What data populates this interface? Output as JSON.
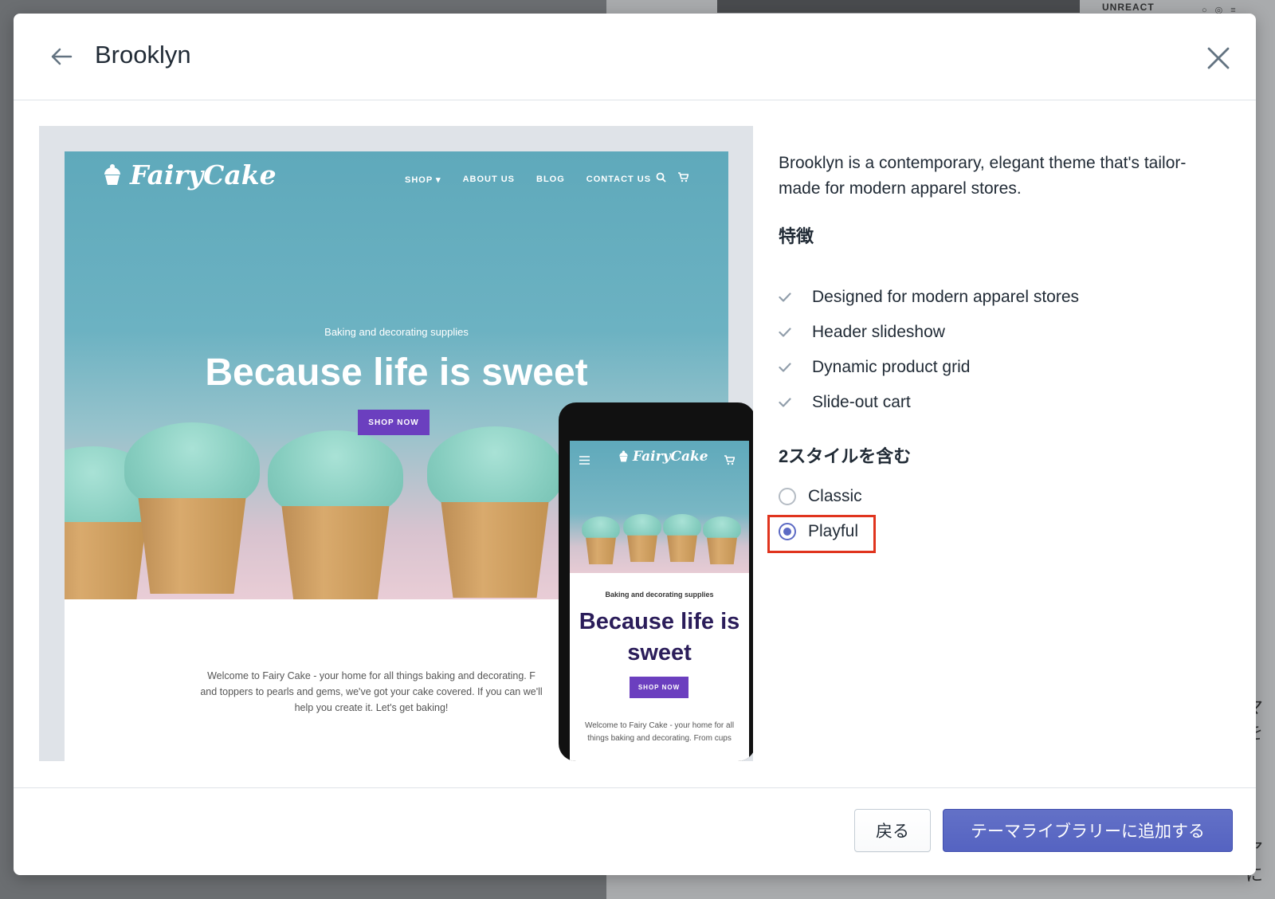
{
  "background": {
    "label": "UNREACT",
    "side_text_1": "マを",
    "side_text_2": "ア に"
  },
  "modal": {
    "title": "Brooklyn",
    "back_icon": "arrow-left-icon",
    "close_icon": "close-icon"
  },
  "preview": {
    "logo_text": "FairyCake",
    "nav": [
      "SHOP",
      "ABOUT US",
      "BLOG",
      "CONTACT US"
    ],
    "hero_subtitle": "Baking and decorating supplies",
    "hero_title": "Because life is sweet",
    "hero_button": "SHOP NOW",
    "welcome_text": "Welcome to Fairy Cake - your home for all things baking and decorating. F and toppers to pearls and gems, we've got your cake covered. If you can we'll help you create it. Let's get baking!",
    "mobile": {
      "logo_text": "FairyCake",
      "hero_subtitle": "Baking and decorating supplies",
      "hero_title": "Because life is sweet",
      "hero_button": "SHOP NOW",
      "welcome_text": "Welcome to Fairy Cake - your home for all things baking and decorating. From cups"
    },
    "accent_color": "#6b3fbf"
  },
  "info": {
    "description": "Brooklyn is a contemporary, elegant theme that's tailor-made for modern apparel stores.",
    "features_heading": "特徴",
    "features": [
      "Designed for modern apparel stores",
      "Header slideshow",
      "Dynamic product grid",
      "Slide-out cart"
    ],
    "styles_heading": "2スタイルを含む",
    "styles": [
      {
        "label": "Classic",
        "selected": false
      },
      {
        "label": "Playful",
        "selected": true
      }
    ]
  },
  "footer": {
    "back_label": "戻る",
    "add_label": "テーマライブラリーに追加する"
  },
  "colors": {
    "primary": "#5c6ac4",
    "highlight": "#e0341e"
  }
}
